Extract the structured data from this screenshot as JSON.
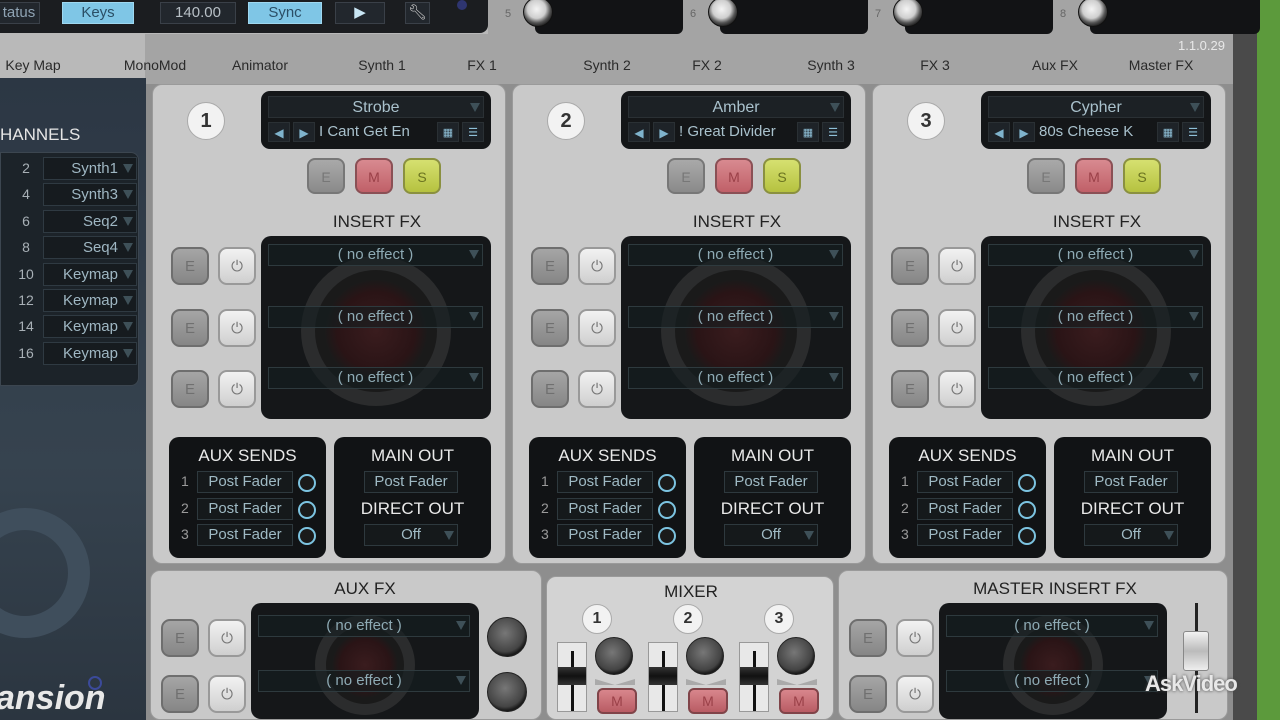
{
  "toolbar": {
    "status_label": "tatus",
    "keys_label": "Keys",
    "tempo": "140.00",
    "sync_label": "Sync",
    "play_icon": "▶",
    "settings_icon": "wrench"
  },
  "macro_knobs": [
    {
      "label": "5"
    },
    {
      "label": "6"
    },
    {
      "label": "7"
    },
    {
      "label": "8"
    }
  ],
  "version": "1.1.0.29",
  "tabs": [
    "Key Map",
    "MonoMod",
    "Animator",
    "Synth 1",
    "FX 1",
    "Synth 2",
    "FX 2",
    "Synth 3",
    "FX 3",
    "Aux FX",
    "Master FX"
  ],
  "sidebar": {
    "heading": "HANNELS",
    "channels": [
      {
        "num": "2",
        "assign": "Synth1"
      },
      {
        "num": "4",
        "assign": "Synth3"
      },
      {
        "num": "6",
        "assign": "Seq2"
      },
      {
        "num": "8",
        "assign": "Seq4"
      },
      {
        "num": "10",
        "assign": "Keymap"
      },
      {
        "num": "12",
        "assign": "Keymap"
      },
      {
        "num": "14",
        "assign": "Keymap"
      },
      {
        "num": "16",
        "assign": "Keymap"
      }
    ],
    "logo_text": "ansion"
  },
  "labels": {
    "insert_fx": "INSERT FX",
    "aux_sends": "AUX SENDS",
    "main_out": "MAIN OUT",
    "direct_out": "DIRECT OUT",
    "e": "E",
    "m": "M",
    "s": "S",
    "aux_fx": "AUX FX",
    "mixer": "MIXER",
    "master_insert_fx": "MASTER INSERT FX",
    "power": "⏻"
  },
  "channels": [
    {
      "number": "1",
      "synth": "Strobe",
      "preset": "I Cant Get En",
      "inserts": [
        "( no effect )",
        "( no effect )",
        "( no effect )"
      ],
      "aux_sends": [
        {
          "num": "1",
          "mode": "Post Fader"
        },
        {
          "num": "2",
          "mode": "Post Fader"
        },
        {
          "num": "3",
          "mode": "Post Fader"
        }
      ],
      "main_out": "Post Fader",
      "direct_out": "Off"
    },
    {
      "number": "2",
      "synth": "Amber",
      "preset": "Great Divider !",
      "inserts": [
        "( no effect )",
        "( no effect )",
        "( no effect )"
      ],
      "aux_sends": [
        {
          "num": "1",
          "mode": "Post Fader"
        },
        {
          "num": "2",
          "mode": "Post Fader"
        },
        {
          "num": "3",
          "mode": "Post Fader"
        }
      ],
      "main_out": "Post Fader",
      "direct_out": "Off"
    },
    {
      "number": "3",
      "synth": "Cypher",
      "preset": "80s Cheese K",
      "inserts": [
        "( no effect )",
        "( no effect )",
        "( no effect )"
      ],
      "aux_sends": [
        {
          "num": "1",
          "mode": "Post Fader"
        },
        {
          "num": "2",
          "mode": "Post Fader"
        },
        {
          "num": "3",
          "mode": "Post Fader"
        }
      ],
      "main_out": "Post Fader",
      "direct_out": "Off"
    }
  ],
  "aux_fx": {
    "slots": [
      "( no effect )",
      "( no effect )"
    ]
  },
  "mixer": {
    "channels": [
      "1",
      "2",
      "3"
    ]
  },
  "master_insert_fx": {
    "slots": [
      "( no effect )",
      "( no effect )"
    ]
  },
  "watermark": "AskVideo",
  "colors": {
    "accent": "#7fc6e6",
    "mute": "#c8707a",
    "solo": "#c8d050"
  }
}
